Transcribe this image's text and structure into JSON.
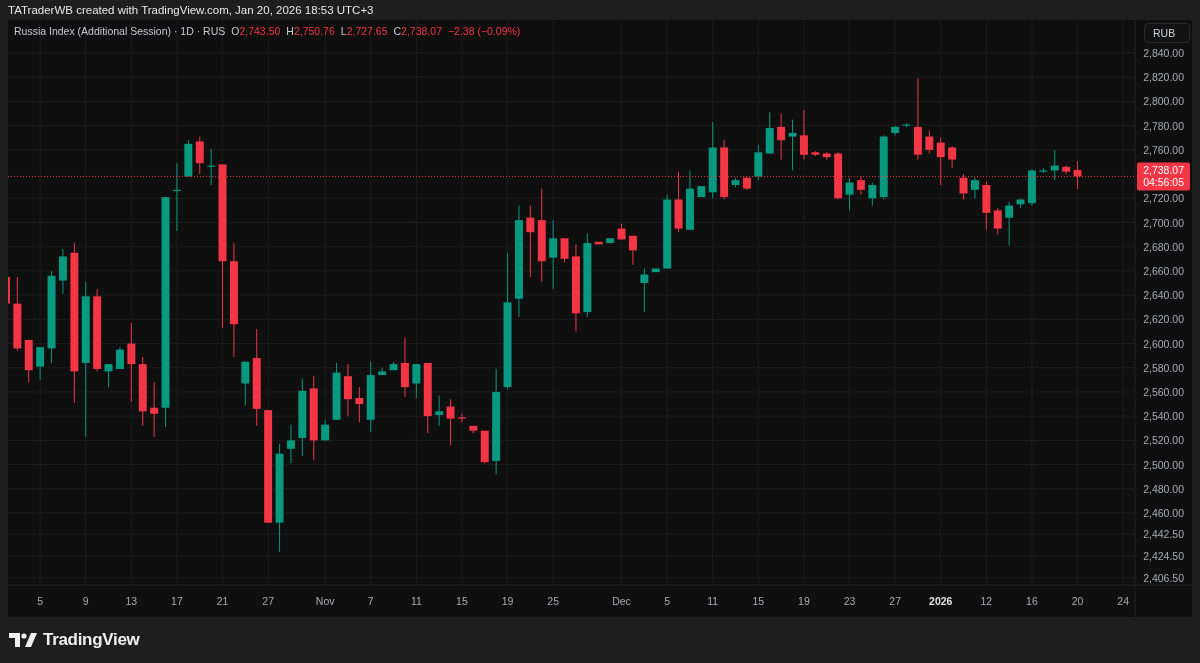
{
  "header": {
    "text": "TATraderWB created with TradingView.com, Jan 20, 2026 18:53 UTC+3"
  },
  "legend": {
    "symbol": "Russia Index (Additional Session) · 1D · RUS",
    "values": [
      {
        "label": "O",
        "value": "2,743.50"
      },
      {
        "label": "H",
        "value": "2,750.76"
      },
      {
        "label": "L",
        "value": "2,727.65"
      },
      {
        "label": "C",
        "value": "2,738.07"
      }
    ],
    "change": "−2.38 (−0.09%)"
  },
  "currency_button": "RUB",
  "last_price": {
    "value": "2,738.07",
    "countdown": "04:56:05"
  },
  "chart_data": {
    "type": "candlestick",
    "grid": true,
    "ylim": [
      2374.1,
      2867.3
    ],
    "categories": [
      null,
      null,
      null,
      "5",
      null,
      null,
      null,
      "9",
      null,
      null,
      null,
      "13",
      null,
      null,
      null,
      "17",
      null,
      null,
      null,
      "21",
      null,
      null,
      null,
      "27",
      null,
      null,
      null,
      null,
      "Nov",
      null,
      null,
      null,
      "7",
      null,
      null,
      null,
      "11",
      null,
      null,
      null,
      "15",
      null,
      null,
      null,
      "19",
      null,
      null,
      null,
      "25",
      null,
      null,
      null,
      null,
      null,
      "Dec",
      null,
      null,
      null,
      "5",
      null,
      null,
      null,
      "11",
      null,
      null,
      null,
      "15",
      null,
      null,
      null,
      "19",
      null,
      null,
      null,
      "23",
      null,
      null,
      null,
      "27",
      null,
      null,
      null,
      "**2026**",
      null,
      null,
      null,
      "12",
      null,
      null,
      null,
      "16",
      null,
      null,
      null,
      "20",
      null,
      null,
      null,
      "24"
    ],
    "ohlc": [
      [
        2655,
        2655,
        2633,
        2633
      ],
      [
        2633,
        2655,
        2594,
        2596
      ],
      [
        2603,
        2603,
        2568,
        2578
      ],
      [
        2581,
        2597,
        2570,
        2597
      ],
      [
        2596,
        2660,
        2584,
        2656
      ],
      [
        2652,
        2678,
        2641,
        2672
      ],
      [
        2675,
        2683,
        2551,
        2577
      ],
      [
        2584,
        2651,
        2523,
        2639
      ],
      [
        2639,
        2645,
        2577,
        2579
      ],
      [
        2577,
        2583,
        2564,
        2583
      ],
      [
        2579,
        2597,
        2579,
        2595
      ],
      [
        2600,
        2617,
        2552,
        2583
      ],
      [
        2583,
        2589,
        2532,
        2544
      ],
      [
        2547,
        2568,
        2523,
        2542
      ],
      [
        2547,
        2721,
        2531,
        2721
      ],
      [
        2726,
        2749,
        2693,
        2727
      ],
      [
        2738,
        2768,
        2738,
        2765
      ],
      [
        2767,
        2771,
        2740,
        2749
      ],
      [
        2746,
        2761,
        2731,
        2747
      ],
      [
        2748,
        2748,
        2613,
        2668
      ],
      [
        2668,
        2683,
        2589,
        2616
      ],
      [
        2567,
        2585,
        2549,
        2585
      ],
      [
        2588,
        2612,
        2532,
        2546
      ],
      [
        2545,
        2545,
        2452,
        2452
      ],
      [
        2452,
        2517,
        2428,
        2509
      ],
      [
        2513,
        2533,
        2501,
        2520
      ],
      [
        2522,
        2571,
        2507,
        2561
      ],
      [
        2563,
        2573,
        2504,
        2520
      ],
      [
        2520,
        2537,
        2520,
        2533
      ],
      [
        2537,
        2584,
        2537,
        2576
      ],
      [
        2573,
        2583,
        2540,
        2554
      ],
      [
        2555,
        2564,
        2535,
        2550
      ],
      [
        2537,
        2585,
        2527,
        2574
      ],
      [
        2574,
        2580,
        2574,
        2577
      ],
      [
        2578,
        2585,
        2578,
        2583
      ],
      [
        2584,
        2605,
        2556,
        2564
      ],
      [
        2567,
        2583,
        2555,
        2583
      ],
      [
        2584,
        2584,
        2526,
        2540
      ],
      [
        2541,
        2557,
        2532,
        2544
      ],
      [
        2548,
        2554,
        2516,
        2538
      ],
      [
        2539,
        2542,
        2535,
        2538
      ],
      [
        2532,
        2532,
        2526,
        2528
      ],
      [
        2528,
        2528,
        2501,
        2502
      ],
      [
        2503,
        2579,
        2492,
        2560
      ],
      [
        2564,
        2675,
        2562,
        2634
      ],
      [
        2637,
        2714,
        2622,
        2702
      ],
      [
        2704,
        2714,
        2655,
        2692
      ],
      [
        2702,
        2728,
        2651,
        2668
      ],
      [
        2671,
        2702,
        2645,
        2687
      ],
      [
        2687,
        2687,
        2667,
        2670
      ],
      [
        2672,
        2682,
        2610,
        2625
      ],
      [
        2626,
        2691,
        2622,
        2683
      ],
      [
        2684,
        2684,
        2682,
        2682
      ],
      [
        2683,
        2687,
        2683,
        2687
      ],
      [
        2695,
        2699,
        2686,
        2686
      ],
      [
        2689,
        2689,
        2665,
        2677
      ],
      [
        2650,
        2662,
        2626,
        2657
      ],
      [
        2659,
        2662,
        2659,
        2662
      ],
      [
        2662,
        2723,
        2662,
        2719
      ],
      [
        2719,
        2742,
        2692,
        2695
      ],
      [
        2694,
        2743,
        2694,
        2728
      ],
      [
        2721,
        2730,
        2721,
        2730
      ],
      [
        2725,
        2783,
        2720,
        2762
      ],
      [
        2762,
        2768,
        2719,
        2721
      ],
      [
        2731,
        2737,
        2729,
        2735
      ],
      [
        2737,
        2738,
        2727,
        2728
      ],
      [
        2738,
        2764,
        2735,
        2758
      ],
      [
        2757,
        2791,
        2757,
        2778
      ],
      [
        2779,
        2790,
        2752,
        2768
      ],
      [
        2771,
        2785,
        2743,
        2774
      ],
      [
        2772,
        2793,
        2752,
        2756
      ],
      [
        2758,
        2759,
        2755,
        2756
      ],
      [
        2757,
        2758,
        2752,
        2754
      ],
      [
        2757,
        2758,
        2719,
        2720
      ],
      [
        2723,
        2737,
        2710,
        2733
      ],
      [
        2735,
        2738,
        2723,
        2727
      ],
      [
        2720,
        2733,
        2714,
        2731
      ],
      [
        2721,
        2772,
        2719,
        2771
      ],
      [
        2774,
        2780,
        2772,
        2779
      ],
      [
        2780,
        2782,
        2779,
        2781
      ],
      [
        2779,
        2819,
        2752,
        2756
      ],
      [
        2771,
        2776,
        2757,
        2760
      ],
      [
        2766,
        2770,
        2731,
        2754
      ],
      [
        2762,
        2763,
        2745,
        2752
      ],
      [
        2737,
        2740,
        2719,
        2724
      ],
      [
        2727,
        2737,
        2720,
        2735
      ],
      [
        2731,
        2734,
        2694,
        2708
      ],
      [
        2710,
        2712,
        2690,
        2695
      ],
      [
        2704,
        2717,
        2681,
        2714
      ],
      [
        2715,
        2720,
        2712,
        2719
      ],
      [
        2716,
        2744,
        2714,
        2743
      ],
      [
        2742,
        2745,
        2741,
        2743
      ],
      [
        2743,
        2760,
        2735,
        2747
      ],
      [
        2746,
        2747,
        2740,
        2742
      ],
      [
        2743.5,
        2750.76,
        2727.65,
        2738.07
      ],
      null,
      null,
      null,
      null
    ],
    "ref_lines": [
      {
        "axis": "y",
        "value": 2738.07
      }
    ],
    "yticks": [
      {
        "value": 2840,
        "label": "2,840.00"
      },
      {
        "value": 2820,
        "label": "2,820.00"
      },
      {
        "value": 2800,
        "label": "2,800.00"
      },
      {
        "value": 2780,
        "label": "2,780.00"
      },
      {
        "value": 2760,
        "label": "2,760.00"
      },
      {
        "value": 2720,
        "label": "2,720.00"
      },
      {
        "value": 2700,
        "label": "2,700.00"
      },
      {
        "value": 2680,
        "label": "2,680.00"
      },
      {
        "value": 2660,
        "label": "2,660.00"
      },
      {
        "value": 2640,
        "label": "2,640.00"
      },
      {
        "value": 2620,
        "label": "2,620.00"
      },
      {
        "value": 2600,
        "label": "2,600.00"
      },
      {
        "value": 2580,
        "label": "2,580.00"
      },
      {
        "value": 2560,
        "label": "2,560.00"
      },
      {
        "value": 2540,
        "label": "2,540.00"
      },
      {
        "value": 2520,
        "label": "2,520.00"
      },
      {
        "value": 2500,
        "label": "2,500.00"
      },
      {
        "value": 2480,
        "label": "2,480.00"
      },
      {
        "value": 2460,
        "label": "2,460.00"
      },
      {
        "value": 2442.5,
        "label": "2,442.50"
      },
      {
        "value": 2424.5,
        "label": "2,424.50"
      },
      {
        "value": 2406.5,
        "label": "2,406.50"
      }
    ]
  },
  "footer": {
    "brand": "TradingView"
  }
}
